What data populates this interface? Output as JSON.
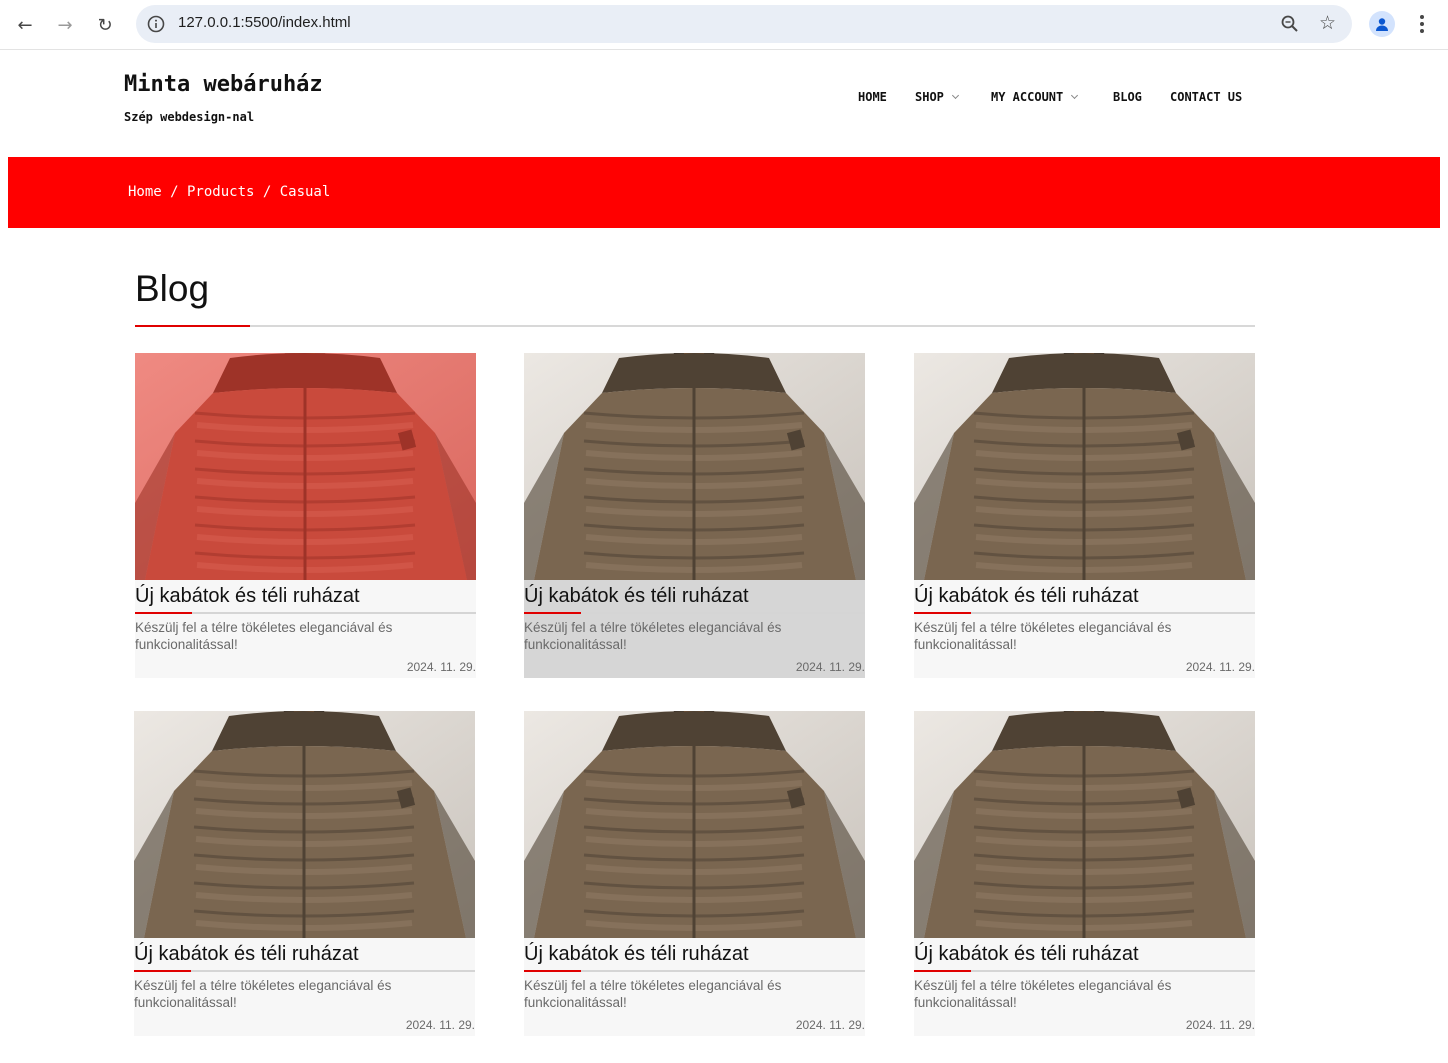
{
  "browser": {
    "url": "127.0.0.1:5500/index.html",
    "icons": [
      "back-arrow-icon",
      "forward-arrow-icon",
      "reload-icon",
      "site-info-icon",
      "zoom-icon",
      "bookmark-star-icon",
      "profile-icon",
      "more-menu-icon"
    ]
  },
  "header": {
    "site_title": "Minta webáruház",
    "tagline": "Szép webdesign-nal",
    "nav": [
      {
        "label": "HOME",
        "has_dropdown": false
      },
      {
        "label": "SHOP",
        "has_dropdown": true
      },
      {
        "label": "MY ACCOUNT",
        "has_dropdown": true
      },
      {
        "label": "BLOG",
        "has_dropdown": false
      },
      {
        "label": "CONTACT US",
        "has_dropdown": false
      }
    ]
  },
  "breadcrumb": {
    "text": "Home / Products / Casual",
    "background": "#ff0000"
  },
  "main": {
    "title": "Blog",
    "accent_color": "#e00000",
    "posts": [
      {
        "title": "Új kabátok és téli ruházat",
        "excerpt": "Készülj fel a télre tökéletes eleganciával és funkcionalitással!",
        "date": "2024. 11. 29.",
        "image": "red-puffer-jacket"
      },
      {
        "title": "Új kabátok és téli ruházat",
        "excerpt": "Készülj fel a télre tökéletes eleganciával és funkcionalitással!",
        "date": "2024. 11. 29.",
        "image": "brown-puffer-jacket"
      },
      {
        "title": "Új kabátok és téli ruházat",
        "excerpt": "Készülj fel a télre tökéletes eleganciával és funkcionalitással!",
        "date": "2024. 11. 29.",
        "image": "brown-puffer-jacket"
      },
      {
        "title": "Új kabátok és téli ruházat",
        "excerpt": "Készülj fel a télre tökéletes eleganciával és funkcionalitással!",
        "date": "2024. 11. 29.",
        "image": "brown-puffer-jacket"
      },
      {
        "title": "Új kabátok és téli ruházat",
        "excerpt": "Készülj fel a télre tökéletes eleganciával és funkcionalitással!",
        "date": "2024. 11. 29.",
        "image": "brown-puffer-jacket"
      },
      {
        "title": "Új kabátok és téli ruházat",
        "excerpt": "Készülj fel a télre tökéletes eleganciával és funkcionalitással!",
        "date": "2024. 11. 29.",
        "image": "brown-puffer-jacket"
      }
    ]
  }
}
